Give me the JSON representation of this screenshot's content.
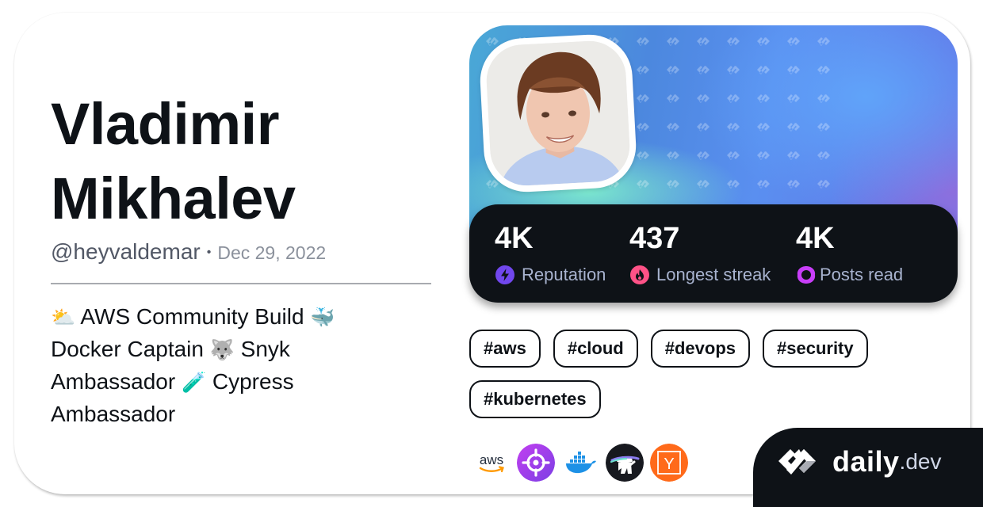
{
  "profile": {
    "name": "Vladimir Mikhalev",
    "handle": "@heyvaldemar",
    "separator": "•",
    "joined_date": "Dec 29, 2022",
    "bio": [
      {
        "type": "emoji",
        "value": "⛅",
        "icon": "sun-behind-cloud-icon"
      },
      {
        "type": "text",
        "value": " AWS Community Build "
      },
      {
        "type": "emoji",
        "value": "🐳",
        "icon": "whale-icon"
      },
      {
        "type": "text",
        "value": " Docker Captain "
      },
      {
        "type": "emoji",
        "value": "🐺",
        "icon": "wolf-icon"
      },
      {
        "type": "text",
        "value": " Snyk Ambassador "
      },
      {
        "type": "emoji",
        "value": "🧪",
        "icon": "test-tube-icon"
      },
      {
        "type": "text",
        "value": " Cypress Ambassador"
      }
    ],
    "avatar_alt": "Profile photo of Vladimir Mikhalev"
  },
  "stats": [
    {
      "value": "4K",
      "label": "Reputation",
      "icon": "lightning-icon",
      "color": "#7147ed"
    },
    {
      "value": "437",
      "label": "Longest streak",
      "icon": "flame-icon",
      "color": "#ff5287"
    },
    {
      "value": "4K",
      "label": "Posts read",
      "icon": "ring-icon",
      "color": "#c83ef8"
    }
  ],
  "tags": [
    "#aws",
    "#cloud",
    "#devops",
    "#security",
    "#kubernetes"
  ],
  "stack": [
    {
      "name": "aws",
      "icon": "aws-logo-icon"
    },
    {
      "name": "Crosshair",
      "icon": "crosshair-logo-icon"
    },
    {
      "name": "Docker",
      "icon": "docker-logo-icon"
    },
    {
      "name": "Astronaut",
      "icon": "astronaut-logo-icon"
    },
    {
      "name": "Y Combinator",
      "icon": "ycombinator-logo-icon",
      "letter": "Y"
    }
  ],
  "brand": {
    "name": "daily",
    "tld": ".dev"
  },
  "colors": {
    "text_primary": "#0e1217",
    "text_secondary": "#525866",
    "stats_bg": "#0e1217",
    "stat_label": "#a8b3cf"
  }
}
